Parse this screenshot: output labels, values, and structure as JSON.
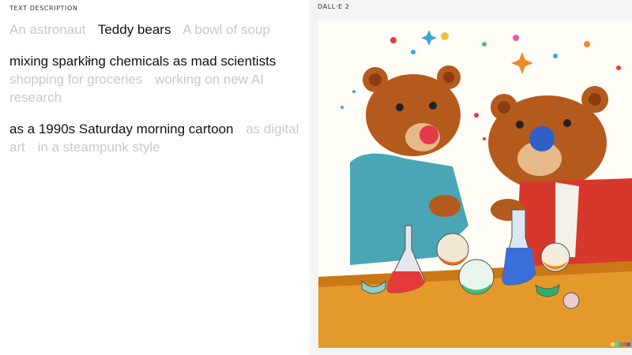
{
  "text_description": {
    "label": "TEXT DESCRIPTION",
    "subject_options": [
      "An astronaut",
      "Teddy bears",
      "A bowl of soup"
    ],
    "action_options": [
      "mixing sparkling chemicals as mad scientists",
      "shopping for groceries",
      "working on new AI research"
    ],
    "style_options": [
      "as a 1990s Saturday morning cartoon",
      "as digital art",
      "in a steampunk style"
    ],
    "selected": {
      "subject": "Teddy bears",
      "action": "mixing sparkling chemicals as mad scientists",
      "style": "as a 1990s Saturday morning cartoon"
    }
  },
  "output": {
    "model_label": "DALL·E 2",
    "image_description_icon": "generated-image",
    "watermark_colors": [
      "#f2e24a",
      "#5ec8e6",
      "#57b847",
      "#ef5a3b",
      "#3a6fd8"
    ]
  }
}
